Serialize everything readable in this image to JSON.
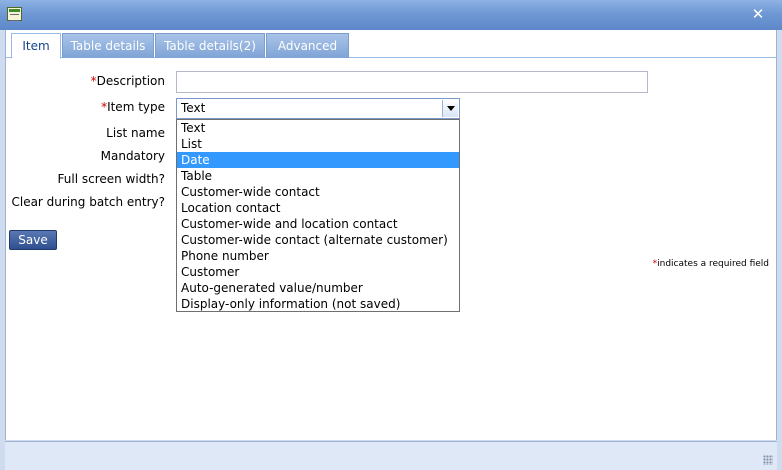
{
  "window": {
    "close_glyph": "✕"
  },
  "tabs": [
    {
      "label": "Item",
      "active": true
    },
    {
      "label": "Table details",
      "active": false
    },
    {
      "label": "Table details(2)",
      "active": false
    },
    {
      "label": "Advanced",
      "active": false
    }
  ],
  "form": {
    "required_marker": "*",
    "description_label": "Description",
    "description_value": "",
    "item_type_label": "Item type",
    "item_type_value": "Text",
    "list_name_label": "List name",
    "mandatory_label": "Mandatory",
    "full_screen_label": "Full screen width?",
    "clear_batch_label": "Clear during batch entry?"
  },
  "dropdown": {
    "highlighted": "Date",
    "options": [
      "Text",
      "List",
      "Date",
      "Table",
      "Customer-wide contact",
      "Location contact",
      "Customer-wide and location contact",
      "Customer-wide contact (alternate customer)",
      "Phone number",
      "Customer",
      "Auto-generated value/number",
      "Display-only information (not saved)"
    ]
  },
  "actions": {
    "save_label": "Save"
  },
  "note": {
    "marker": "*",
    "text": "indicates a required field"
  },
  "colors": {
    "title_bar": "#6f98d4",
    "tab_active_text": "#15428b",
    "required": "#cc0000",
    "highlight": "#3399ff"
  },
  "icons": {
    "app": "form-window-icon",
    "close": "close-icon",
    "dropdown": "chevron-down-icon",
    "resize": "resize-grip-icon"
  }
}
